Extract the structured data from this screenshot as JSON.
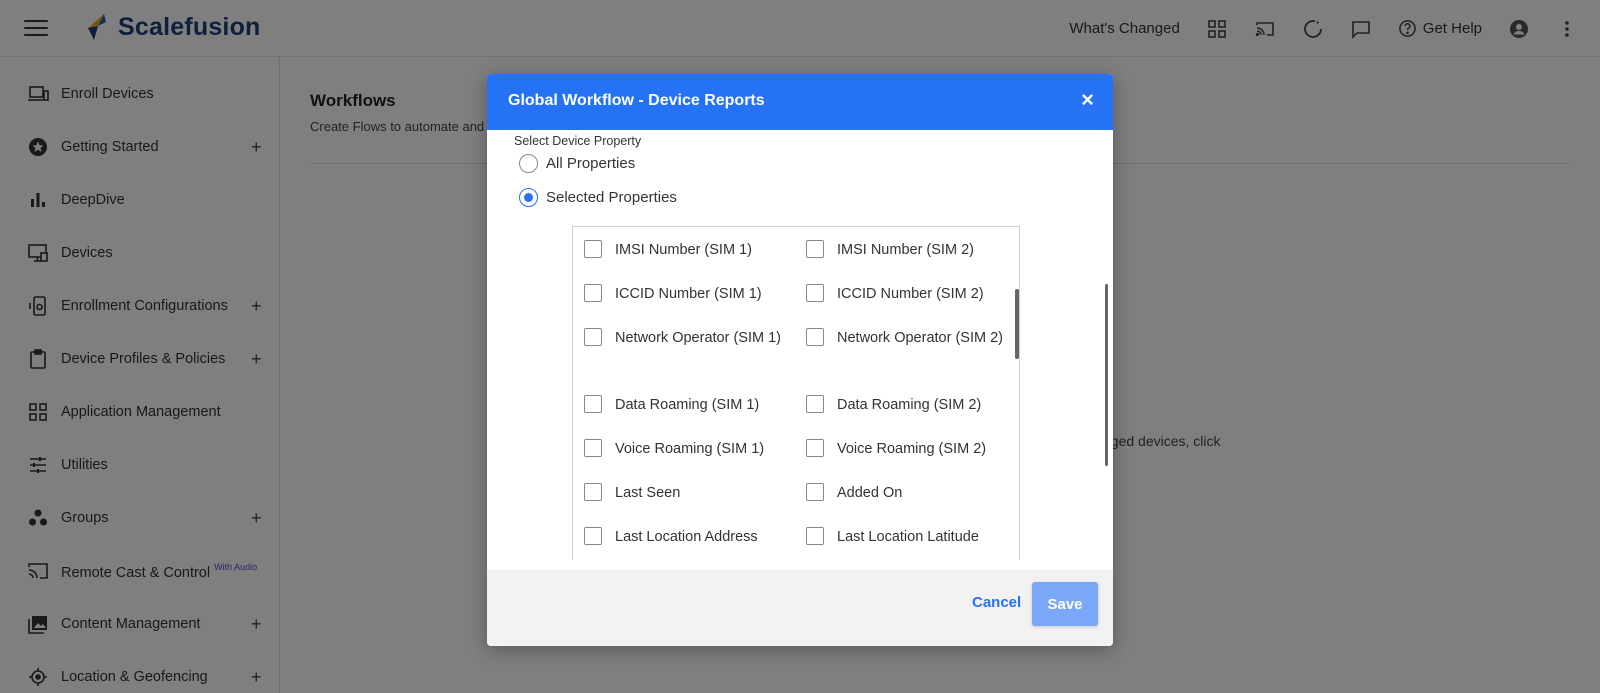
{
  "brand": {
    "name": "Scalefusion",
    "accent": "#2572f5"
  },
  "topbar": {
    "whats_changed": "What's Changed",
    "get_help": "Get Help",
    "icons": [
      "grid-icon",
      "cast-icon",
      "refresh-icon",
      "chat-icon",
      "help-icon",
      "account-icon",
      "more-vert-icon"
    ]
  },
  "sidebar": {
    "items": [
      {
        "label": "Enroll Devices",
        "icon": "devices-icon",
        "expandable": false
      },
      {
        "label": "Getting Started",
        "icon": "star-icon",
        "expandable": true
      },
      {
        "label": "DeepDive",
        "icon": "bar-chart-icon",
        "expandable": false
      },
      {
        "label": "Devices",
        "icon": "monitor-icon",
        "expandable": false
      },
      {
        "label": "Enrollment Configurations",
        "icon": "phone-config-icon",
        "expandable": true
      },
      {
        "label": "Device Profiles & Policies",
        "icon": "clipboard-icon",
        "expandable": true
      },
      {
        "label": "Application Management",
        "icon": "apps-grid-icon",
        "expandable": false
      },
      {
        "label": "Utilities",
        "icon": "sliders-icon",
        "expandable": false
      },
      {
        "label": "Groups",
        "icon": "groups-icon",
        "expandable": true
      },
      {
        "label": "Remote Cast & Control",
        "badge": "With Audio",
        "icon": "cast-icon",
        "expandable": false
      },
      {
        "label": "Content Management",
        "icon": "photo-library-icon",
        "expandable": true
      },
      {
        "label": "Location & Geofencing",
        "icon": "location-icon",
        "expandable": true
      }
    ],
    "plus": "+"
  },
  "main": {
    "title": "Workflows",
    "subtitle": "Create Flows to automate and s",
    "bg_text": "aged devices, click"
  },
  "modal": {
    "title": "Global Workflow - Device Reports",
    "close": "×",
    "section_label": "Select Device Property",
    "radios": [
      {
        "label": "All Properties",
        "checked": false
      },
      {
        "label": "Selected Properties",
        "checked": true
      }
    ],
    "properties": [
      [
        "IMSI Number (SIM 1)",
        "IMSI Number (SIM 2)"
      ],
      [
        "ICCID Number (SIM 1)",
        "ICCID Number (SIM 2)"
      ],
      [
        "Network Operator (SIM 1)",
        "Network Operator (SIM 2)"
      ],
      [
        "Data Roaming (SIM 1)",
        "Data Roaming (SIM 2)"
      ],
      [
        "Voice Roaming (SIM 1)",
        "Voice Roaming (SIM 2)"
      ],
      [
        "Last Seen",
        "Added On"
      ],
      [
        "Last Location Address",
        "Last Location Latitude"
      ]
    ],
    "cancel_label": "Cancel",
    "save_label": "Save"
  }
}
